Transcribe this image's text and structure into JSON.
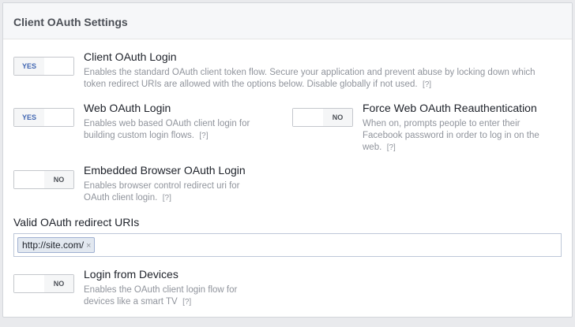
{
  "panel": {
    "title": "Client OAuth Settings"
  },
  "settings": {
    "client_oauth_login": {
      "toggle": "YES",
      "title": "Client OAuth Login",
      "description": "Enables the standard OAuth client token flow. Secure your application and prevent abuse by locking down which token redirect URIs are allowed with the options below. Disable globally if not used.",
      "help": "[?]"
    },
    "web_oauth_login": {
      "toggle": "YES",
      "title": "Web OAuth Login",
      "description": "Enables web based OAuth client login for building custom login flows.",
      "help": "[?]"
    },
    "force_web_oauth_reauth": {
      "toggle": "NO",
      "title": "Force Web OAuth Reauthentication",
      "description": "When on, prompts people to enter their Facebook password in order to log in on the web.",
      "help": "[?]"
    },
    "embedded_browser_oauth_login": {
      "toggle": "NO",
      "title": "Embedded Browser OAuth Login",
      "description": "Enables browser control redirect uri for OAuth client login.",
      "help": "[?]"
    },
    "login_from_devices": {
      "toggle": "NO",
      "title": "Login from Devices",
      "description": "Enables the OAuth client login flow for devices like a smart TV",
      "help": "[?]"
    }
  },
  "redirect_uris": {
    "label": "Valid OAuth redirect URIs",
    "tokens": [
      "http://site.com/"
    ],
    "remove_glyph": "×"
  },
  "colors": {
    "accent": "#4267b2",
    "background": "#e9eaed",
    "muted_text": "#90949c"
  }
}
